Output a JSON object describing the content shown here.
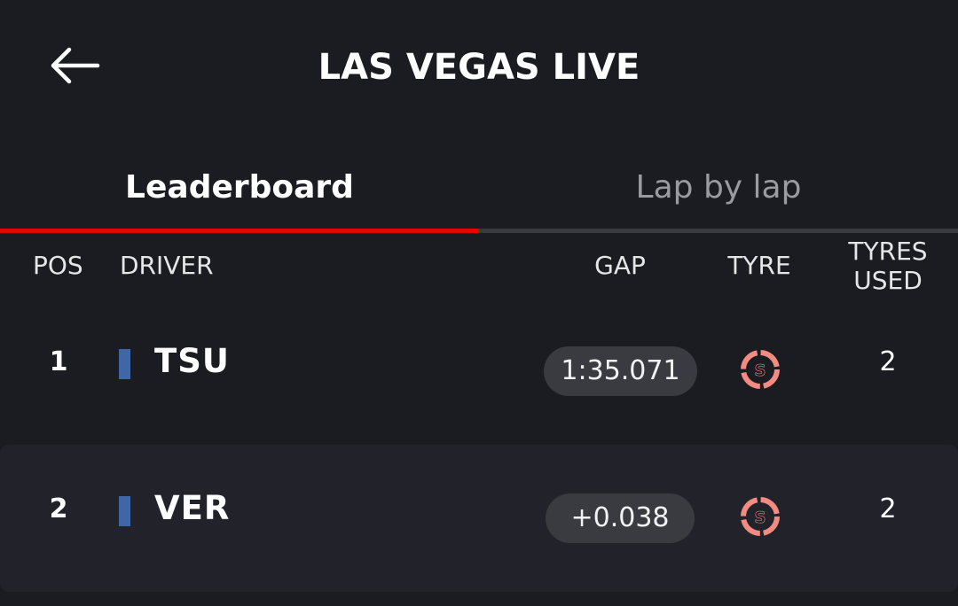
{
  "header": {
    "title": "LAS VEGAS LIVE",
    "back_icon": "back-arrow-icon"
  },
  "tabs": [
    {
      "label": "Leaderboard",
      "active": true
    },
    {
      "label": "Lap by lap",
      "active": false
    }
  ],
  "colors": {
    "background": "#1b1b22",
    "active_tab_indicator": "#e10600",
    "team_bar": "#3f67a8",
    "pill": "#3a3b41",
    "soft_tyre": "#f28b82"
  },
  "columns": {
    "pos": "POS",
    "driver": "DRIVER",
    "gap": "GAP",
    "tyre": "TYRE",
    "tyres_used": "TYRES\nUSED"
  },
  "rows": [
    {
      "pos": "1",
      "driver": "TSU",
      "gap": "1:35.071",
      "tyre": "S",
      "tyres_used": "2"
    },
    {
      "pos": "2",
      "driver": "VER",
      "gap": "+0.038",
      "tyre": "S",
      "tyres_used": "2"
    }
  ]
}
